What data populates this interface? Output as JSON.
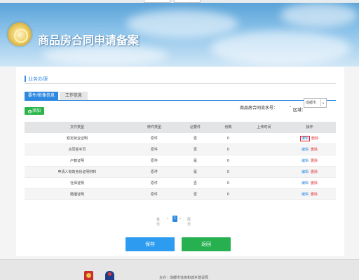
{
  "header": {
    "title": "商品房合同申请备案"
  },
  "section": {
    "title": "业务办理"
  },
  "tabs": [
    {
      "label": "要件/影像信息",
      "active": true
    },
    {
      "label": "工作信息",
      "active": false
    }
  ],
  "toolbar": {
    "add_label": "添加",
    "contract_no_label": "商品房合同流水号：",
    "contract_no_value": "-",
    "district_label": "区域：",
    "district_value": "成都市"
  },
  "table": {
    "headers": [
      "文件类型",
      "修件类型",
      "必要件",
      "份数",
      "上传时间",
      "操作"
    ],
    "rows": [
      {
        "file_type": "稳定就业证明",
        "doc_type": "原件",
        "required": "否",
        "count": "0",
        "upload_time": "",
        "edit": "编辑",
        "delete": "删除"
      },
      {
        "file_type": "合同签字页",
        "doc_type": "原件",
        "required": "否",
        "count": "0",
        "upload_time": "",
        "edit": "编辑",
        "delete": "删除"
      },
      {
        "file_type": "户籍证明",
        "doc_type": "原件",
        "required": "是",
        "count": "0",
        "upload_time": "",
        "edit": "编辑",
        "delete": "删除"
      },
      {
        "file_type": "申请人有效身份证明材料",
        "doc_type": "原件",
        "required": "是",
        "count": "0",
        "upload_time": "",
        "edit": "编辑",
        "delete": "删除"
      },
      {
        "file_type": "社保证明",
        "doc_type": "原件",
        "required": "否",
        "count": "0",
        "upload_time": "",
        "edit": "编辑",
        "delete": "删除"
      },
      {
        "file_type": "婚姻证明",
        "doc_type": "原件",
        "required": "否",
        "count": "0",
        "upload_time": "",
        "edit": "编辑",
        "delete": "删除"
      }
    ]
  },
  "pagination": {
    "first": "首页",
    "prev": "‹",
    "current": "1",
    "next": "›",
    "last": "尾页"
  },
  "actions": {
    "save_label": "保存",
    "back_label": "返回"
  },
  "footer": {
    "text": "主办：成都市住房和城乡建设局"
  },
  "colors": {
    "primary": "#2d88e0",
    "success": "#26b04f",
    "danger": "#e03b3b"
  }
}
